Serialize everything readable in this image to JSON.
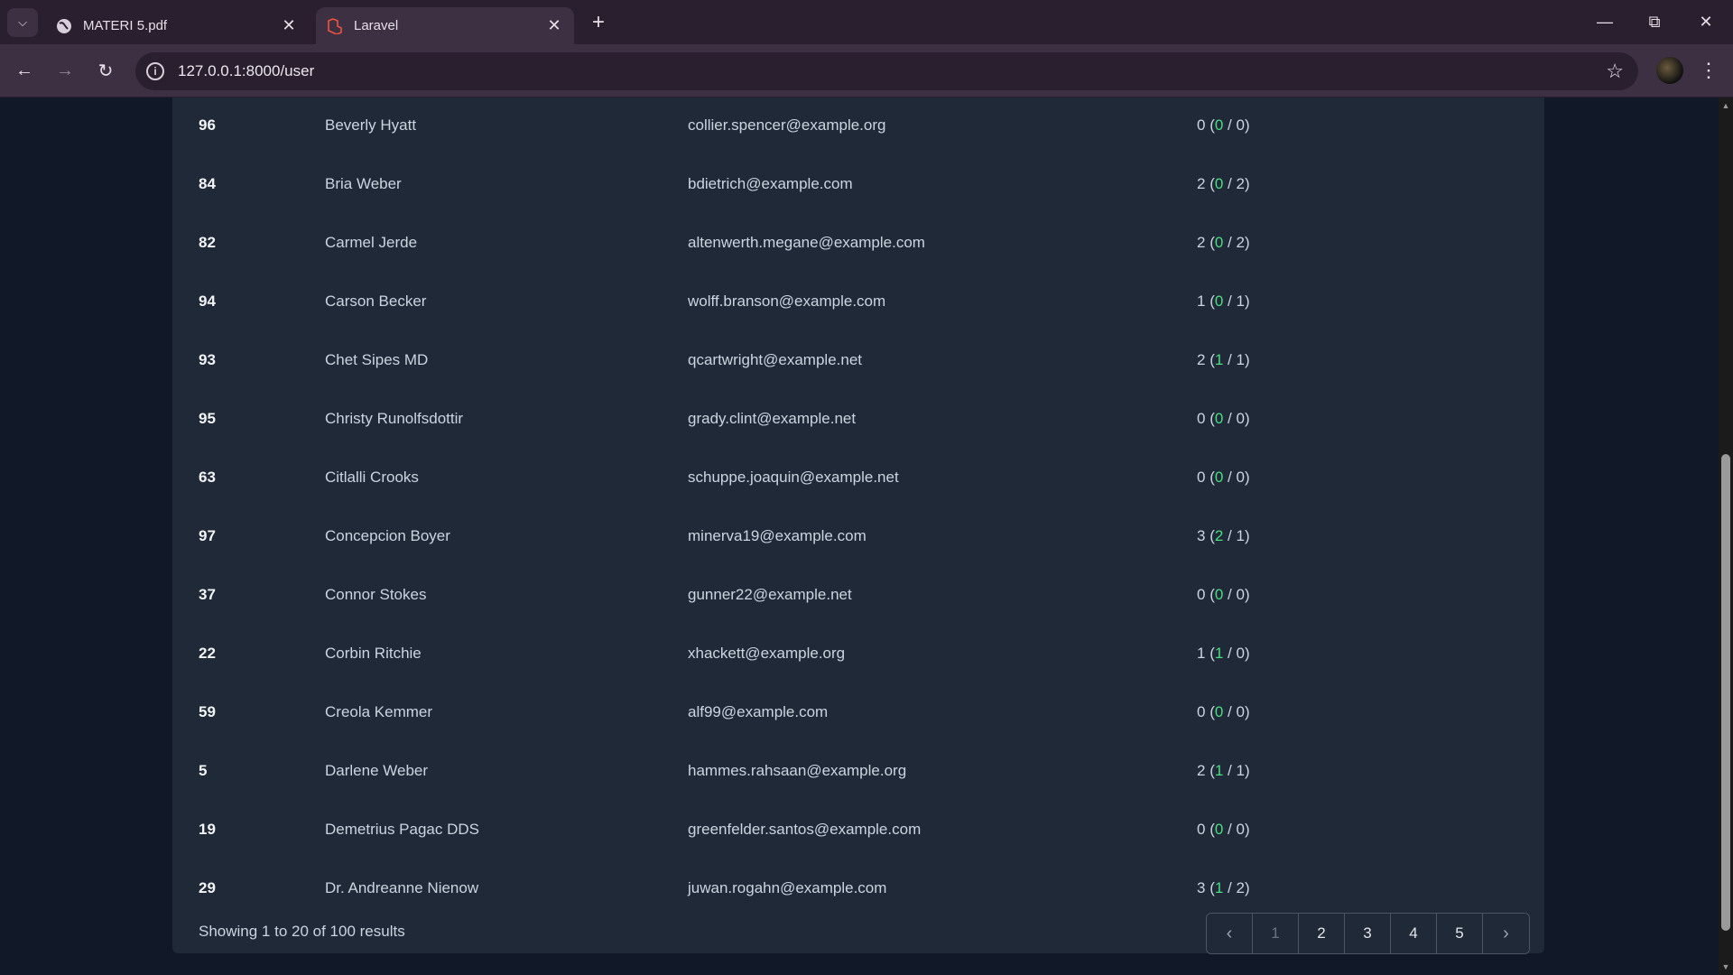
{
  "browser": {
    "tabs": [
      {
        "title": "MATERI 5.pdf",
        "icon": "globe-icon"
      },
      {
        "title": "Laravel",
        "icon": "laravel-icon"
      }
    ],
    "url": "127.0.0.1:8000/user"
  },
  "users": [
    {
      "id": "96",
      "name": "Beverly Hyatt",
      "email": "collier.spencer@example.org",
      "total": "0",
      "a": "0",
      "b": "0"
    },
    {
      "id": "84",
      "name": "Bria Weber",
      "email": "bdietrich@example.com",
      "total": "2",
      "a": "0",
      "b": "2"
    },
    {
      "id": "82",
      "name": "Carmel Jerde",
      "email": "altenwerth.megane@example.com",
      "total": "2",
      "a": "0",
      "b": "2"
    },
    {
      "id": "94",
      "name": "Carson Becker",
      "email": "wolff.branson@example.com",
      "total": "1",
      "a": "0",
      "b": "1"
    },
    {
      "id": "93",
      "name": "Chet Sipes MD",
      "email": "qcartwright@example.net",
      "total": "2",
      "a": "1",
      "b": "1"
    },
    {
      "id": "95",
      "name": "Christy Runolfsdottir",
      "email": "grady.clint@example.net",
      "total": "0",
      "a": "0",
      "b": "0"
    },
    {
      "id": "63",
      "name": "Citlalli Crooks",
      "email": "schuppe.joaquin@example.net",
      "total": "0",
      "a": "0",
      "b": "0"
    },
    {
      "id": "97",
      "name": "Concepcion Boyer",
      "email": "minerva19@example.com",
      "total": "3",
      "a": "2",
      "b": "1"
    },
    {
      "id": "37",
      "name": "Connor Stokes",
      "email": "gunner22@example.net",
      "total": "0",
      "a": "0",
      "b": "0"
    },
    {
      "id": "22",
      "name": "Corbin Ritchie",
      "email": "xhackett@example.org",
      "total": "1",
      "a": "1",
      "b": "0"
    },
    {
      "id": "59",
      "name": "Creola Kemmer",
      "email": "alf99@example.com",
      "total": "0",
      "a": "0",
      "b": "0"
    },
    {
      "id": "5",
      "name": "Darlene Weber",
      "email": "hammes.rahsaan@example.org",
      "total": "2",
      "a": "1",
      "b": "1"
    },
    {
      "id": "19",
      "name": "Demetrius Pagac DDS",
      "email": "greenfelder.santos@example.com",
      "total": "0",
      "a": "0",
      "b": "0"
    },
    {
      "id": "29",
      "name": "Dr. Andreanne Nienow",
      "email": "juwan.rogahn@example.com",
      "total": "3",
      "a": "1",
      "b": "2"
    }
  ],
  "pagination": {
    "summary": "Showing 1 to 20 of 100 results",
    "pages": [
      "1",
      "2",
      "3",
      "4",
      "5"
    ],
    "current": "1"
  },
  "colors": {
    "accent_green": "#4ade80",
    "background": "#111827",
    "card": "#1f2937"
  }
}
